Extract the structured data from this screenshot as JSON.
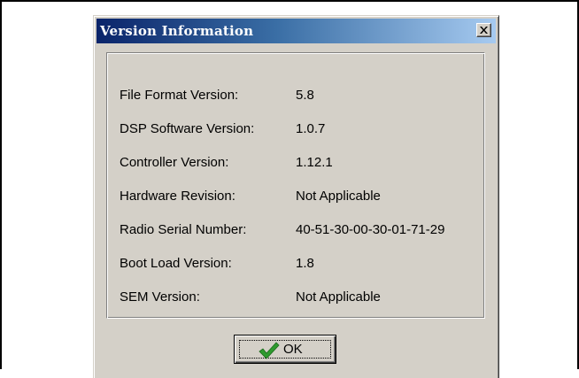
{
  "dialog": {
    "title": "Version Information",
    "close_icon": "close-icon"
  },
  "info_rows": [
    {
      "label": "File Format Version:",
      "value": "5.8"
    },
    {
      "label": "DSP Software Version:",
      "value": "1.0.7"
    },
    {
      "label": "Controller Version:",
      "value": "1.12.1"
    },
    {
      "label": "Hardware Revision:",
      "value": "Not Applicable"
    },
    {
      "label": "Radio Serial Number:",
      "value": "40-51-30-00-30-01-71-29"
    },
    {
      "label": "Boot Load Version:",
      "value": "1.8"
    },
    {
      "label": "SEM Version:",
      "value": "Not Applicable"
    }
  ],
  "ok_button": {
    "label": "OK",
    "icon": "checkmark-icon"
  },
  "colors": {
    "title_bar_start": "#0a246a",
    "title_bar_end": "#a6caf0",
    "dialog_face": "#d4d0c8",
    "checkmark": "#2e9a2e"
  }
}
